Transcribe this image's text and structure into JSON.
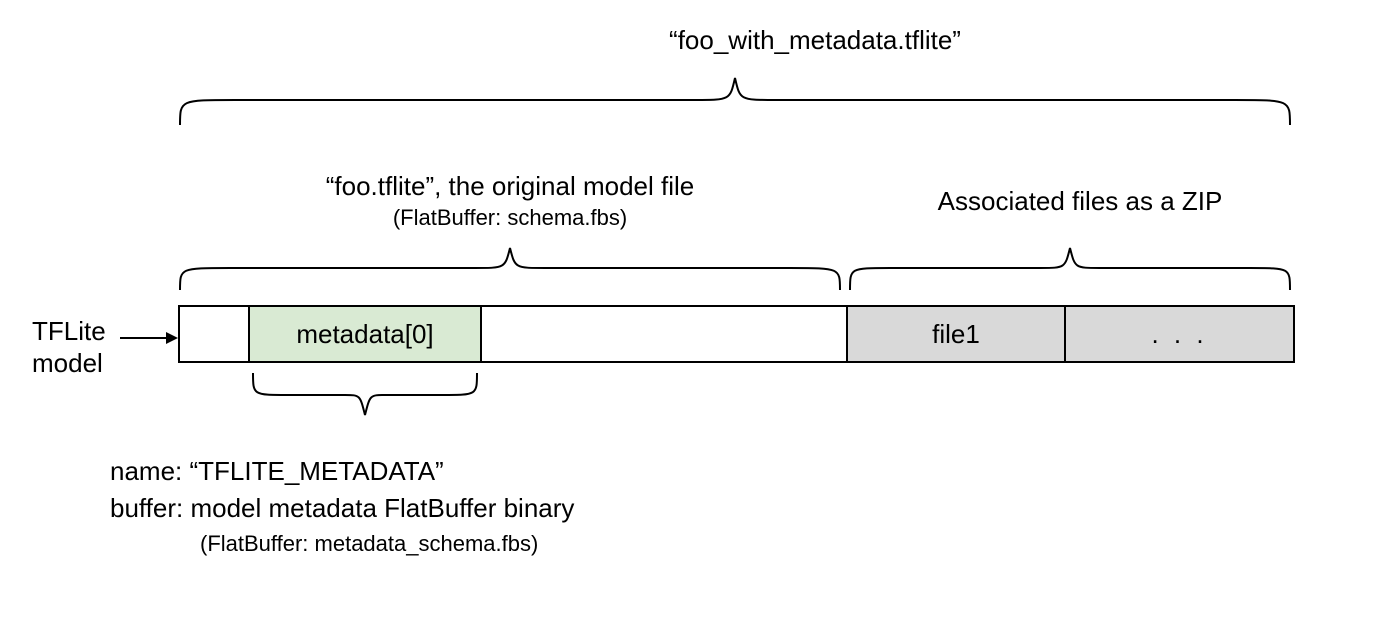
{
  "top_filename": "“foo_with_metadata.tflite”",
  "original_label_main": "“foo.tflite”, the original model file",
  "original_label_sub": "(FlatBuffer: schema.fbs)",
  "zip_label": "Associated files as a ZIP",
  "tflite_model_line1": "TFLite",
  "tflite_model_line2": "model",
  "metadata_box": "metadata[0]",
  "file1_box": "file1",
  "ellipsis_box": ". . .",
  "bottom_name": "name: “TFLITE_METADATA”",
  "bottom_buffer": "buffer: model metadata FlatBuffer binary",
  "bottom_sub": "(FlatBuffer: metadata_schema.fbs)"
}
